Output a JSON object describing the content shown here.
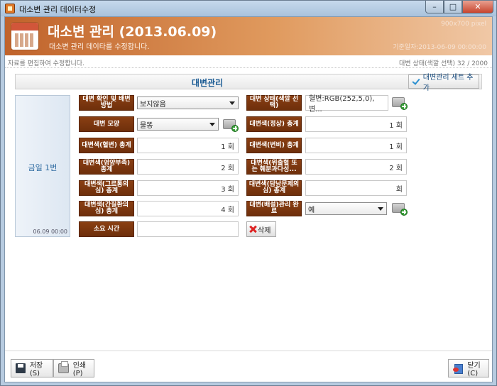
{
  "window": {
    "title": "대소변 관리 데이터수정",
    "min_glyph": "–",
    "max_glyph": "□",
    "close_glyph": "✕"
  },
  "header": {
    "title": "대소변 관리 (2013.06.09)",
    "subtitle": "대소변 관리 데이타를 수정합니다.",
    "size_note": "900x700 pixel",
    "base_note": "기준일자:2013-06-09 00:00:00"
  },
  "status": {
    "left": "자료를 편집하여 수정합니다.",
    "right": "대변 상태(색깔 선택) 32 / 2000"
  },
  "section": {
    "title": "대변관리",
    "add_set_label": "대변관리 세트 추가"
  },
  "left_panel": {
    "name": "금일 1번",
    "time": "06.09 00:00"
  },
  "form": {
    "check_method_label": "대변 확인 및 배변 방법",
    "check_method_value": "보지않음",
    "stool_state_label": "대변 상태(색깔 선택)",
    "stool_state_value": "혈변:RGB(252,5,0), 변...",
    "shape_label": "대변 모양",
    "shape_value": "물똥",
    "normal_color_label": "대변색(정상) 총계",
    "normal_color_value": "1 회",
    "bloody_label": "대변색(혈변) 총계",
    "bloody_value": "1 회",
    "black_label": "대변색(변비) 총계",
    "black_value": "1 회",
    "nutrition_label": "대변색(영양부족) 총계",
    "nutrition_value": "2 회",
    "gastric_label": "대변색(위출혈 또는 췌분과다성...",
    "gastric_value": "2 회",
    "green_label": "대변색(그르통의심) 총계",
    "green_value": "3 회",
    "gallbladder_label": "대변색(담낭문제의심) 총계",
    "gallbladder_value": "회",
    "liver_label": "대변색(간질환의심) 총계",
    "liver_value": "4 회",
    "done_label": "대변(배설)관리 완료",
    "done_value": "예",
    "duration_label": "소요 시간",
    "duration_value": "",
    "delete_label": "삭제"
  },
  "footer": {
    "save_label": "저장(S)",
    "print_label": "인쇄(P)",
    "close_label": "닫기(C)"
  }
}
